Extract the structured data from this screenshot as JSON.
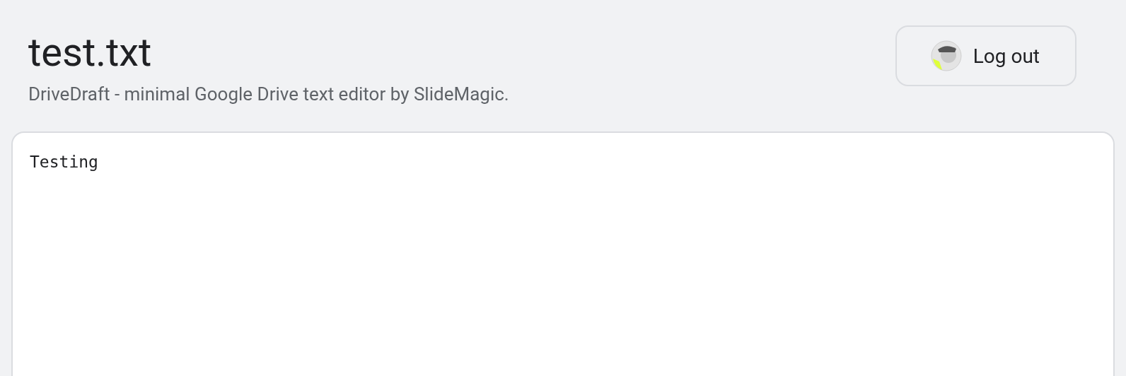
{
  "header": {
    "title": "test.txt",
    "subtitle": "DriveDraft - minimal Google Drive text editor by SlideMagic."
  },
  "logout_button": {
    "label": "Log out"
  },
  "editor": {
    "value": "Testing"
  }
}
